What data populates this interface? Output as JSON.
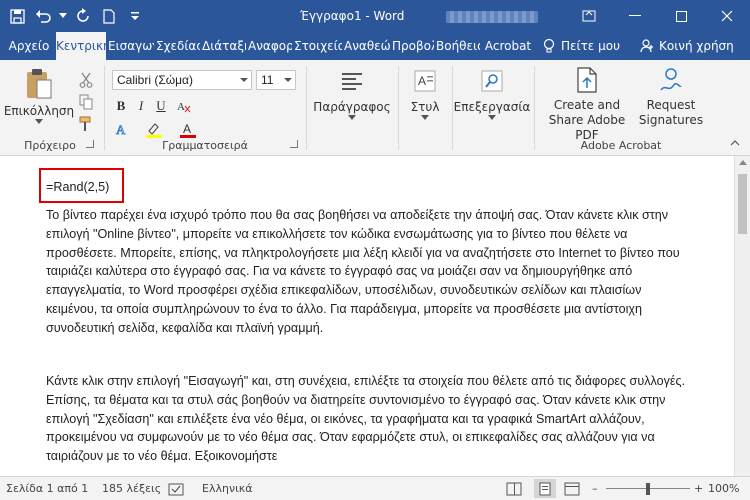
{
  "window": {
    "title": "Έγγραφο1 - Word"
  },
  "tabs": [
    {
      "label": "Αρχείο",
      "active": false
    },
    {
      "label": "Κεντρική",
      "active": true
    },
    {
      "label": "Εισαγωγή",
      "active": false
    },
    {
      "label": "Σχεδίαση",
      "active": false
    },
    {
      "label": "Διάταξη",
      "active": false
    },
    {
      "label": "Αναφορές",
      "active": false
    },
    {
      "label": "Στοιχεία αλληλογραφίας",
      "active": false
    },
    {
      "label": "Αναθεώρηση",
      "active": false
    },
    {
      "label": "Προβολή",
      "active": false
    },
    {
      "label": "Βοήθεια",
      "active": false
    },
    {
      "label": "Acrobat",
      "active": false
    }
  ],
  "tell_me": "Πείτε μου",
  "share": "Κοινή χρήση",
  "ribbon": {
    "clipboard": {
      "paste_label": "Επικόλληση",
      "group_label": "Πρόχειρο"
    },
    "font": {
      "font_name": "Calibri (Σώμα)",
      "font_size": "11",
      "group_label": "Γραμματοσειρά",
      "bold": "B",
      "italic": "I",
      "underline": "U"
    },
    "paragraph": {
      "label": "Παράγραφος"
    },
    "styles": {
      "label": "Στυλ"
    },
    "editing": {
      "label": "Επεξεργασία"
    },
    "acrobat": {
      "create_pdf": "Create and Share Adobe PDF",
      "request_sig": "Request Signatures",
      "group_label": "Adobe Acrobat"
    }
  },
  "document": {
    "first_line": "=Rand(2,5)",
    "paragraphs": [
      "Το βίντεο παρέχει ένα ισχυρό τρόπο που θα σας βοηθήσει να αποδείξετε την άποψή σας. Όταν κάνετε κλικ στην επιλογή \"Online βίντεο\", μπορείτε να επικολλήσετε τον κώδικα ενσωμάτωσης για το βίντεο που θέλετε να προσθέσετε. Μπορείτε, επίσης, να πληκτρολογήσετε μια λέξη κλειδί για να αναζητήσετε στο Internet το βίντεο που ταιριάζει καλύτερα στο έγγραφό σας. Για να κάνετε το έγγραφό σας να μοιάζει σαν να δημιουργήθηκε από επαγγελματία, το Word προσφέρει σχέδια επικεφαλίδων, υποσέλιδων, συνοδευτικών σελίδων και πλαισίων κειμένου, τα οποία συμπληρώνουν το ένα το άλλο. Για παράδειγμα, μπορείτε να προσθέσετε μια αντίστοιχη συνοδευτική σελίδα, κεφαλίδα και πλαϊνή γραμμή.",
      "Κάντε κλικ στην επιλογή \"Εισαγωγή\" και, στη συνέχεια, επιλέξτε τα στοιχεία που θέλετε από τις διάφορες συλλογές. Επίσης, τα θέματα και τα στυλ σάς βοηθούν να διατηρείτε συντονισμένο το έγγραφό σας. Όταν κάνετε κλικ στην επιλογή \"Σχεδίαση\" και επιλέξετε ένα νέο θέμα, οι εικόνες, τα γραφήματα και τα γραφικά SmartArt αλλάζουν, προκειμένου να συμφωνούν με το νέο θέμα σας. Όταν εφαρμόζετε στυλ, οι επικεφαλίδες σας αλλάζουν για να ταιριάζουν με το νέο θέμα. Εξοικονομήστε"
    ]
  },
  "status": {
    "page": "Σελίδα 1 από 1",
    "words": "185 λέξεις",
    "language": "Ελληνικά",
    "zoom": "100%"
  },
  "colors": {
    "accent": "#2b579a",
    "highlight": "#e00000"
  }
}
